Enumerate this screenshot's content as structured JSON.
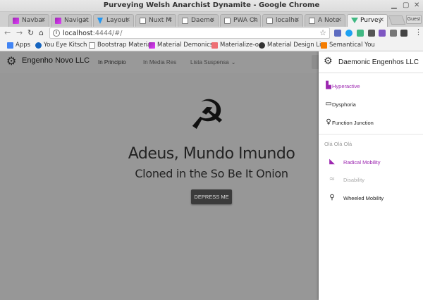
{
  "window": {
    "title": "Purveying Welsh Anarchist Dynamite - Google Chrome"
  },
  "tabs": [
    {
      "label": "Navbar",
      "icon": "gradient-favicon-icon"
    },
    {
      "label": "Navigat",
      "icon": "gradient-favicon-icon"
    },
    {
      "label": "Layout",
      "icon": "blue-favicon-icon"
    },
    {
      "label": "Nuxt M",
      "icon": "document-icon"
    },
    {
      "label": "Daemo",
      "icon": "document-icon"
    },
    {
      "label": "PWA Ch",
      "icon": "document-icon"
    },
    {
      "label": "localho",
      "icon": "document-icon"
    },
    {
      "label": "A Note",
      "icon": "document-icon"
    },
    {
      "label": "Purvey",
      "icon": "vue-icon",
      "active": true
    }
  ],
  "guest_label": "Guest",
  "toolbar": {
    "url_host": "localhost",
    "url_path": ":4444/#/"
  },
  "bookmarks": [
    {
      "label": "Apps",
      "color": "#4285f4"
    },
    {
      "label": "You Eye Kitsch",
      "color": "#1565c0"
    },
    {
      "label": "Bootstrap Materia",
      "color": "#ffffff"
    },
    {
      "label": "Material Demonics",
      "color": "#9c27b0"
    },
    {
      "label": "Materialize-o",
      "color": "#ee6e73"
    },
    {
      "label": "Material Design Li",
      "color": "#333333"
    },
    {
      "label": "Semantical You",
      "color": "#f57c00"
    }
  ],
  "app": {
    "brand": "Engenho Novo LLC",
    "nav": [
      "In Principio",
      "In Media Res",
      "Lista Suspensa"
    ],
    "hero": {
      "title": "Adeus, Mundo Imundo",
      "subtitle": "Cloned in the So Be It Onion",
      "button": "DEPRESS ME"
    }
  },
  "drawer": {
    "title": "Daemonic Engenhos LLC",
    "items": [
      {
        "label": "Hyperactive",
        "icon": "sitemap-icon",
        "state": "active"
      },
      {
        "label": "Dysphoria",
        "icon": "monitor-icon",
        "state": "normal"
      },
      {
        "label": "Function Junction",
        "icon": "lightbulb-icon",
        "state": "normal"
      }
    ],
    "section": "Olá Olá Olá",
    "sub_items": [
      {
        "label": "Radical Mobility",
        "icon": "satellite-dish-icon",
        "state": "active"
      },
      {
        "label": "Disability",
        "icon": "swimmer-icon",
        "state": "disabled"
      },
      {
        "label": "Wheeled Mobility",
        "icon": "bicycle-icon",
        "state": "normal"
      }
    ]
  },
  "colors": {
    "accent": "#9c27b0",
    "overlay": "#979797",
    "button": "#3b3b3b"
  }
}
